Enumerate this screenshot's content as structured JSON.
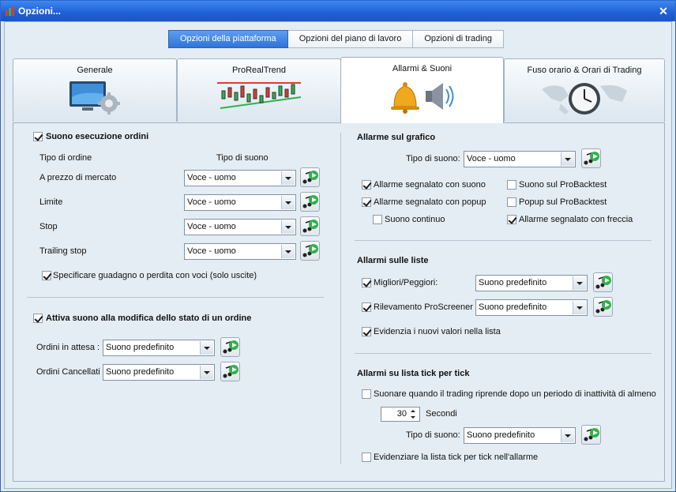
{
  "window": {
    "title": "Opzioni..."
  },
  "top_tabs": [
    "Opzioni della piattaforma",
    "Opzioni del piano di lavoro",
    "Opzioni di trading"
  ],
  "categories": [
    "Generale",
    "ProRealTrend",
    "Allarmi & Suoni",
    "Fuso orario & Orari di Trading"
  ],
  "left": {
    "order_sound": {
      "title": "Suono esecuzione ordini",
      "col_order": "Tipo di ordine",
      "col_sound": "Tipo di suono",
      "rows": [
        {
          "label": "A prezzo di mercato",
          "value": "Voce - uomo"
        },
        {
          "label": "Limite",
          "value": "Voce - uomo"
        },
        {
          "label": "Stop",
          "value": "Voce - uomo"
        },
        {
          "label": "Trailing stop",
          "value": "Voce - uomo"
        }
      ],
      "specify": "Specificare guadagno o perdita con voci (solo uscite)"
    },
    "status_sound": {
      "title": "Attiva suono alla modifica dello stato di un ordine",
      "rows": [
        {
          "label": "Ordini in attesa :",
          "value": "Suono predefinito"
        },
        {
          "label": "Ordini Cancellati",
          "value": "Suono predefinito"
        }
      ]
    }
  },
  "right": {
    "chart_alarms": {
      "title": "Allarme sul grafico",
      "sound_type_label": "Tipo di suono:",
      "sound_type_value": "Voce - uomo",
      "options": {
        "with_sound": "Allarme segnalato con suono",
        "probacktest_sound": "Suono sul ProBacktest",
        "with_popup": "Allarme segnalato con popup",
        "probacktest_popup": "Popup sul ProBacktest",
        "continuous": "Suono continuo",
        "with_arrow": "Allarme segnalato con freccia"
      }
    },
    "list_alarms": {
      "title": "Allarmi sulle liste",
      "rows": [
        {
          "label": "Migliori/Peggiori:",
          "value": "Suono predefinito"
        },
        {
          "label": "Rilevamento ProScreener",
          "value": "Suono predefinito"
        }
      ],
      "highlight": "Evidenzia i nuovi valori nella lista"
    },
    "tick_alarms": {
      "title": "Allarmi su lista tick per tick",
      "resume": "Suonare quando il trading riprende dopo un periodo di inattività di almeno",
      "seconds_value": "30",
      "seconds_label": "Secondi",
      "sound_type_label": "Tipo di suono:",
      "sound_type_value": "Suono predefinito",
      "highlight": "Evidenziare la lista tick per tick nell'allarme"
    }
  }
}
